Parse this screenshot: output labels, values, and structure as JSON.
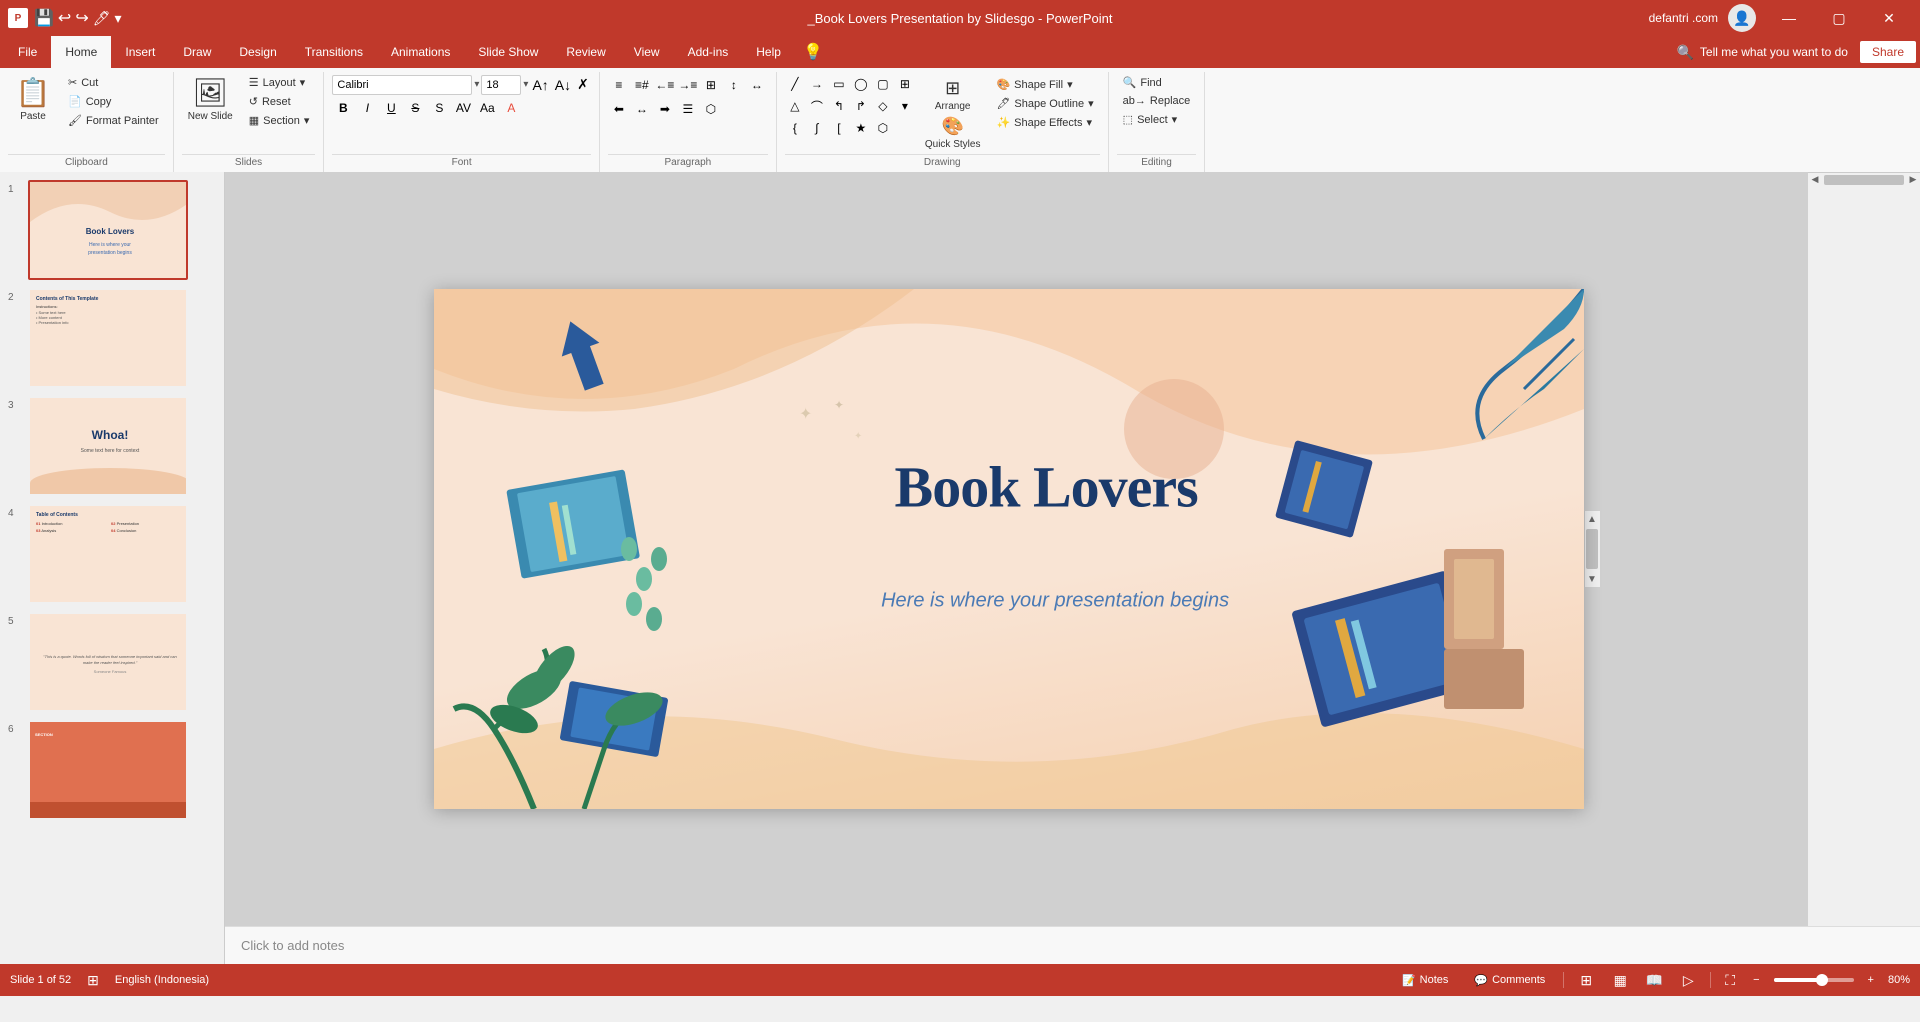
{
  "titleBar": {
    "appName": "PowerPoint",
    "fileName": "_Book Lovers Presentation by Slidesgo - PowerPoint",
    "userName": "defantri .com",
    "quickAccess": [
      "save",
      "undo",
      "redo",
      "customize"
    ]
  },
  "ribbon": {
    "tabs": [
      "File",
      "Home",
      "Insert",
      "Draw",
      "Design",
      "Transitions",
      "Animations",
      "Slide Show",
      "Review",
      "View",
      "Add-ins",
      "Help"
    ],
    "activeTab": "Home",
    "tellMe": "Tell me what you want to do",
    "shareLabel": "Share",
    "groups": {
      "clipboard": {
        "label": "Clipboard",
        "paste": "Paste",
        "cut": "Cut",
        "copy": "Copy",
        "formatPainter": "Format Painter"
      },
      "slides": {
        "label": "Slides",
        "newSlide": "New Slide",
        "layout": "Layout",
        "reset": "Reset",
        "section": "Section"
      },
      "font": {
        "label": "Font",
        "fontName": "Calibri",
        "fontSize": "18",
        "bold": "B",
        "italic": "I",
        "underline": "U",
        "strikethrough": "S",
        "shadow": "S",
        "charSpacing": "AV",
        "changeCase": "Aa",
        "fontColor": "A"
      },
      "paragraph": {
        "label": "Paragraph",
        "bulletList": "≡",
        "numberedList": "≡",
        "decreaseIndent": "←",
        "increaseIndent": "→",
        "alignLeft": "≡",
        "alignCenter": "≡",
        "alignRight": "≡",
        "justify": "≡",
        "columns": "⊞",
        "lineSpacing": "↕",
        "direction": "↔"
      },
      "drawing": {
        "label": "Drawing",
        "arrange": "Arrange",
        "quickStyles": "Quick Styles",
        "shapeFill": "Shape Fill",
        "shapeOutline": "Shape Outline",
        "shapeEffects": "Shape Effects"
      },
      "editing": {
        "label": "Editing",
        "find": "Find",
        "replace": "Replace",
        "select": "Select"
      }
    }
  },
  "slidePanel": {
    "slides": [
      {
        "number": 1,
        "label": "Book Lovers - Title",
        "active": true
      },
      {
        "number": 2,
        "label": "Contents of This Template"
      },
      {
        "number": 3,
        "label": "Whoa!"
      },
      {
        "number": 4,
        "label": "Table of Contents"
      },
      {
        "number": 5,
        "label": "Quote slide"
      },
      {
        "number": 6,
        "label": "Section divider"
      }
    ]
  },
  "mainSlide": {
    "title": "Book Lovers",
    "subtitle": "Here is where your presentation begins"
  },
  "statusBar": {
    "slideInfo": "Slide 1 of 52",
    "language": "English (Indonesia)",
    "notes": "Notes",
    "comments": "Comments",
    "zoom": "80%",
    "notesPlaceholder": "Click to add notes"
  },
  "icons": {
    "save": "💾",
    "undo": "↩",
    "redo": "↪",
    "paste": "📋",
    "newSlide": "＋",
    "bold": "B",
    "italic": "I",
    "underline": "U",
    "find": "🔍",
    "share": "👤",
    "close": "✕",
    "minimize": "—",
    "maximize": "▢",
    "chevronDown": "▾",
    "notes": "📝",
    "comments": "💬",
    "normalView": "⊞",
    "slidesorter": "▦",
    "reading": "📖",
    "fullscreen": "⛶"
  }
}
